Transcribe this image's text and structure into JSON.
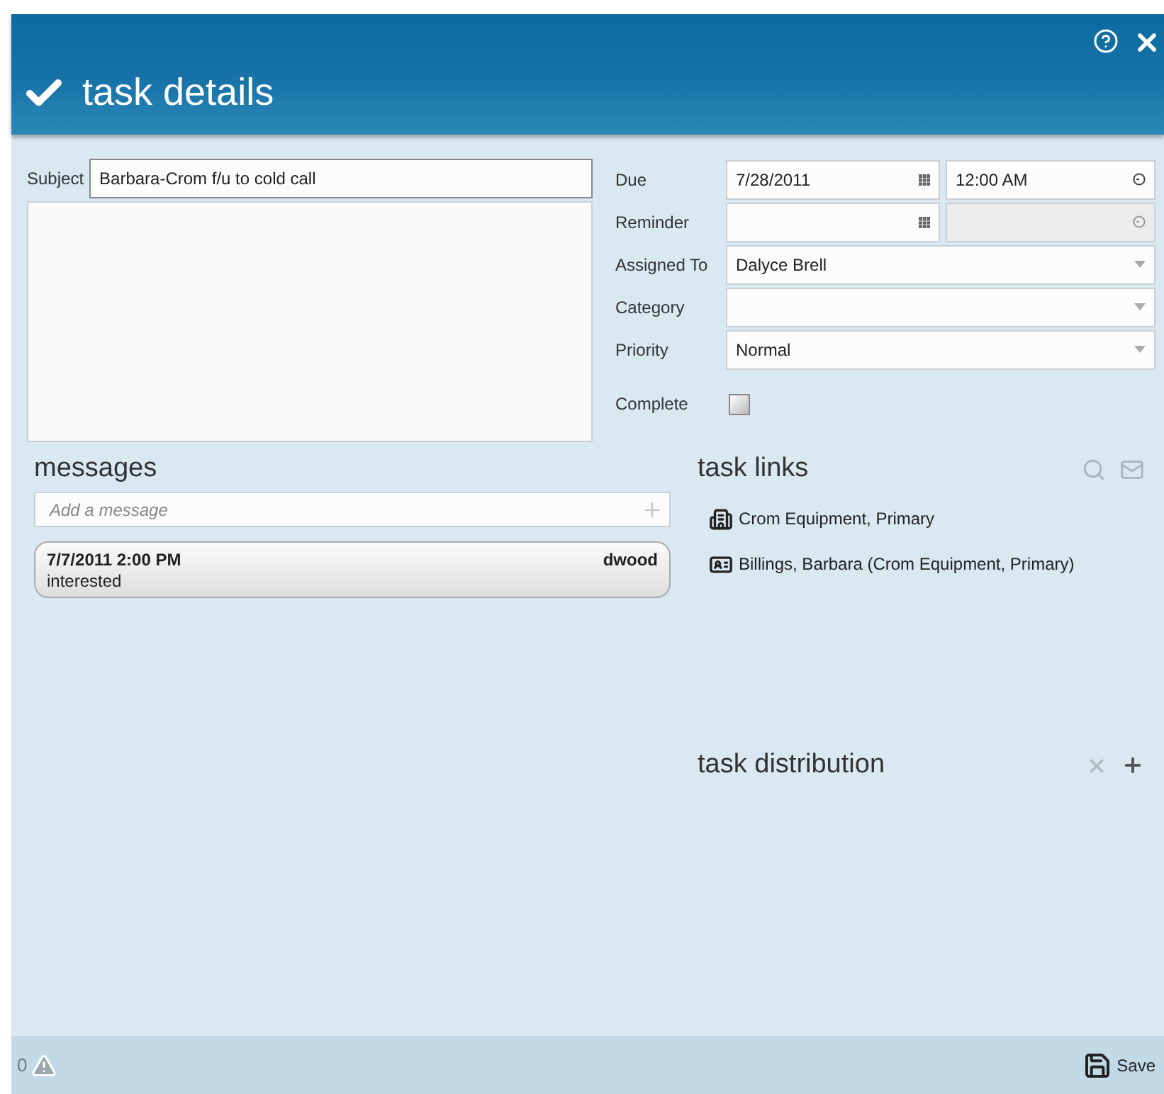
{
  "header": {
    "title": "task details"
  },
  "subject": {
    "label": "Subject",
    "value": "Barbara-Crom f/u to cold call"
  },
  "fields": [
    {
      "label": "Due",
      "kind": "datetime",
      "date": "7/28/2011",
      "time": "12:00 AM",
      "time_disabled": false
    },
    {
      "label": "Reminder",
      "kind": "datetime",
      "time_disabled": true
    },
    {
      "label": "Assigned To",
      "kind": "select",
      "value": "Dalyce Brell"
    },
    {
      "label": "Category",
      "kind": "select"
    },
    {
      "label": "Priority",
      "kind": "select",
      "value": "Normal"
    },
    {
      "label": "Complete",
      "kind": "checkbox",
      "checked": false
    }
  ],
  "messages": {
    "title": "messages",
    "placeholder": "Add a message",
    "items": [
      {
        "time": "7/7/2011 2:00 PM",
        "author": "dwood",
        "text": "interested"
      }
    ]
  },
  "task_links": {
    "title": "task links",
    "items": [
      {
        "kind": "company",
        "label": "Crom Equipment, Primary"
      },
      {
        "kind": "contact",
        "label": "Billings, Barbara (Crom Equipment, Primary)"
      }
    ]
  },
  "task_distribution": {
    "title": "task distribution"
  },
  "footer": {
    "count": "0",
    "save": "Save"
  }
}
